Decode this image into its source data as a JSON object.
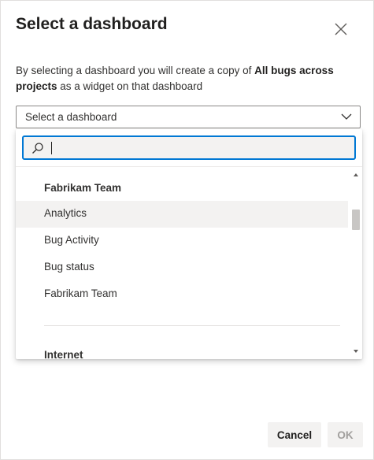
{
  "dialog": {
    "title": "Select a dashboard",
    "description": {
      "prefix": "By selecting a dashboard you will create a copy of ",
      "bold": "All bugs across projects",
      "suffix": " as a widget on that dashboard"
    }
  },
  "select": {
    "value": "Select a dashboard"
  },
  "search": {
    "value": ""
  },
  "groups": [
    {
      "header": "Fabrikam Team",
      "items": [
        "Analytics",
        "Bug Activity",
        "Bug status",
        "Fabrikam Team"
      ]
    },
    {
      "header": "Internet",
      "items": []
    }
  ],
  "buttons": {
    "cancel": "Cancel",
    "ok": "OK"
  },
  "icons": {
    "close": "close-icon",
    "chevron": "chevron-down-icon",
    "search": "search-icon",
    "scroll_up": "scroll-up-icon",
    "scroll_down": "scroll-down-icon"
  },
  "colors": {
    "accent": "#0078d4",
    "hover": "#f3f2f1",
    "disabled_text": "#a19f9d"
  }
}
